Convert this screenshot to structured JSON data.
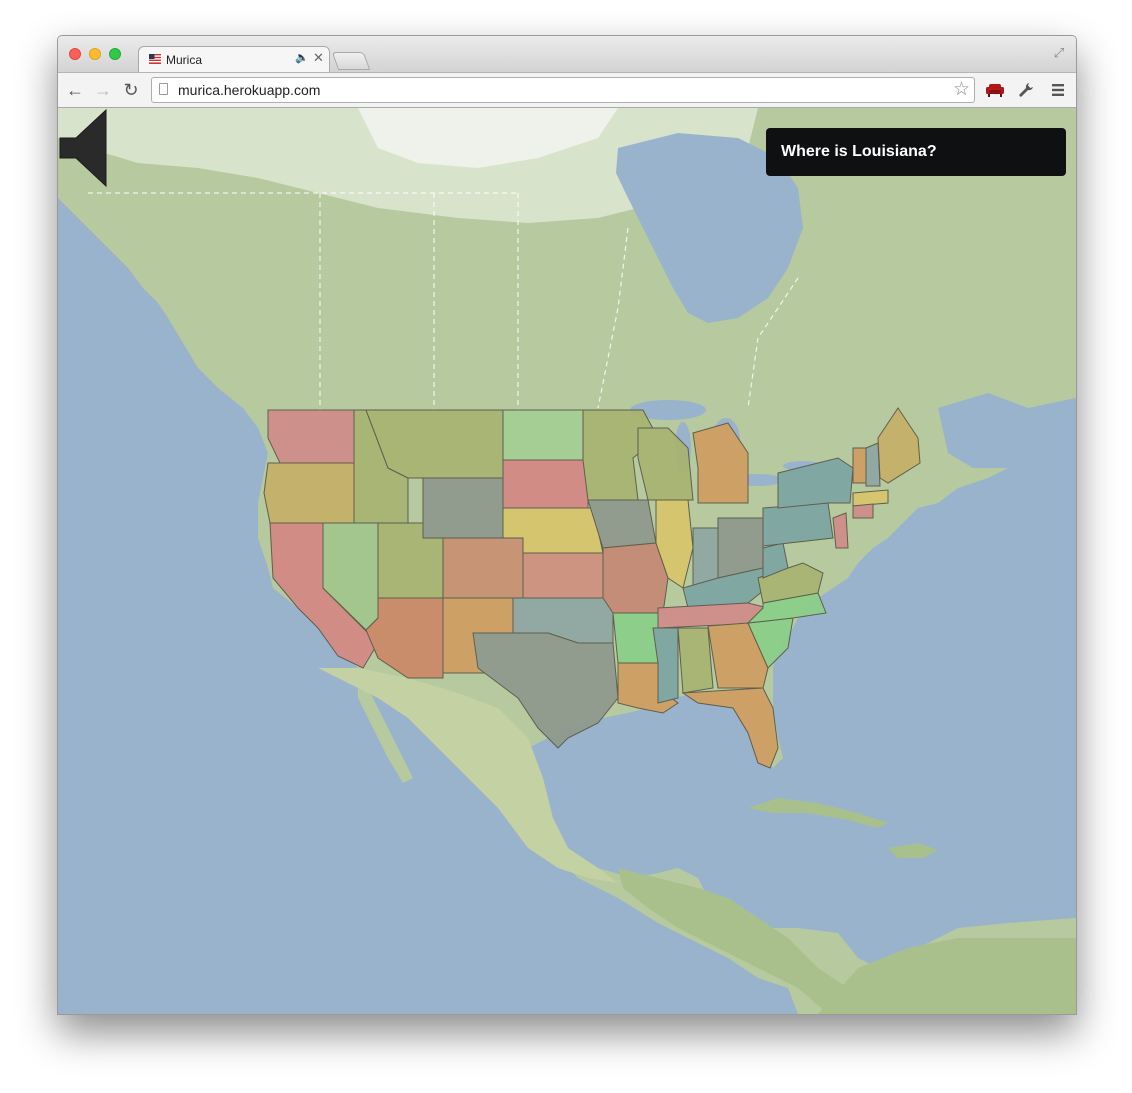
{
  "browser": {
    "tab_title": "Murica",
    "url": "murica.herokuapp.com",
    "icons": {
      "back": "back-arrow-icon",
      "forward": "forward-arrow-icon",
      "reload": "reload-icon",
      "bookmark": "star-icon",
      "extension": "red-couch-icon",
      "wrench": "wrench-icon",
      "menu": "hamburger-menu-icon"
    }
  },
  "game": {
    "question": "Where is Louisiana?",
    "sound_icon": "speaker-icon"
  },
  "colors": {
    "ocean": "#99b3cc",
    "land": "#b3c79b",
    "question_bg": "#0f1012",
    "question_text": "#ffffff"
  }
}
